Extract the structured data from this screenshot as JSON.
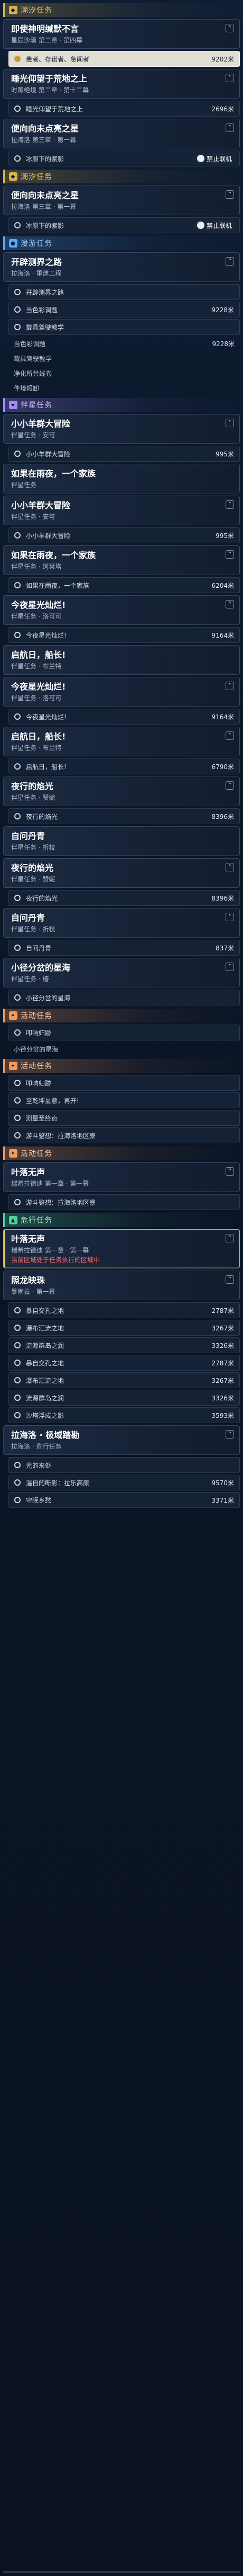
{
  "sections": {
    "chaoxi": "潮汐任务",
    "manyou": "漫游任务",
    "banxing": "伴星任务",
    "huodong": "活动任务",
    "weixian": "危行任务"
  },
  "cards": {
    "c1": {
      "title": "即使神明缄默不言",
      "sub": "星辰沙漠 第二章 · 第四幕"
    },
    "c2": {
      "title": "睡光仰望于荒地之上",
      "sub": "时隙绝境 第二章 · 第十二幕"
    },
    "c3": {
      "title": "便向向未点亮之星",
      "sub": "拉海洛 第三章 · 第一幕"
    },
    "c4": {
      "title": "便向向未点亮之星",
      "sub": "拉海洛 第三章 · 第一幕"
    },
    "c5": {
      "title": "开辟测界之路",
      "sub": "拉海洛 · 重建工程"
    },
    "c6": {
      "title": "小小羊群大冒险",
      "sub": "伴星任务 · 安可"
    },
    "c7": {
      "title": "如果在雨夜，一个家族",
      "sub": "伴星任务"
    },
    "c8": {
      "title": "小小羊群大冒险",
      "sub": "伴星任务 · 安可"
    },
    "c9": {
      "title": "如果在雨夜，一个家族",
      "sub": "伴星任务 · 珂莱塔"
    },
    "c10": {
      "title": "今夜星光灿烂!",
      "sub": "伴星任务 · 洛可可"
    },
    "c11": {
      "title": "启航日，船长!",
      "sub": "伴星任务 · 布兰特"
    },
    "c12": {
      "title": "今夜星光灿烂!",
      "sub": "伴星任务 · 洛可可"
    },
    "c13": {
      "title": "启航日，船长!",
      "sub": "伴星任务 · 布兰特"
    },
    "c14": {
      "title": "夜行的焰光",
      "sub": "伴星任务 · 赞妮"
    },
    "c15": {
      "title": "自问丹青",
      "sub": "伴星任务 · 折枝"
    },
    "c16": {
      "title": "夜行的焰光",
      "sub": "伴星任务 · 赞妮"
    },
    "c17": {
      "title": "自问丹青",
      "sub": "伴星任务 · 折枝"
    },
    "c18": {
      "title": "小径分岔的星海",
      "sub": "伴星任务 · 椿"
    },
    "c19": {
      "title": "叶落无声",
      "sub": "瑞希拉德迪 第一章 · 第一幕"
    },
    "c20": {
      "title": "叶落无声",
      "sub": "瑞希拉德迪 第一章 · 第一幕",
      "warn": "当前区域处于任务执行的区域中"
    },
    "c21": {
      "title": "照龙映珠",
      "sub": "暴雨云 · 第一幕"
    },
    "c22": {
      "title": "拉海洛 · 极域踏勘",
      "sub": "拉海洛 · 危行任务"
    }
  },
  "rows": {
    "r1": {
      "label": "患者、存诺者、急闻者",
      "dist": "9202米"
    },
    "r2": {
      "label": "睡光仰望于荒地之上",
      "dist": "2696米"
    },
    "r3": {
      "label": "冰原下的紫影",
      "dist": ""
    },
    "r4": {
      "label": "冰原下的紫影",
      "dist": ""
    },
    "r5": {
      "label": "开辟测界之路",
      "dist": ""
    },
    "r6": {
      "label": "当色彩调题",
      "dist": "9228米"
    },
    "r7": {
      "label": "载具驾驶教学",
      "dist": ""
    },
    "r8": {
      "label": "当色彩调题",
      "dist": "9228米"
    },
    "r9": {
      "label": "载具驾驶教学",
      "dist": ""
    },
    "r10": {
      "label": "净化所共线卷",
      "dist": ""
    },
    "r11": {
      "label": "件境短卸",
      "dist": ""
    },
    "r12": {
      "label": "小小羊群大冒险",
      "dist": "995米"
    },
    "r13": {
      "label": "小小羊群大冒险",
      "dist": "995米"
    },
    "r14": {
      "label": "如果在雨夜，一个家族",
      "dist": "6204米"
    },
    "r15": {
      "label": "今夜星光灿烂!",
      "dist": "9164米"
    },
    "r16": {
      "label": "今夜星光灿烂!",
      "dist": "9164米"
    },
    "r17": {
      "label": "启航日，船长!",
      "dist": "6790米"
    },
    "r18": {
      "label": "夜行的焰光",
      "dist": "8396米"
    },
    "r19": {
      "label": "夜行的焰光",
      "dist": "8396米"
    },
    "r20": {
      "label": "自问丹青",
      "dist": "837米"
    },
    "r21": {
      "label": "小径分岔的星海",
      "dist": ""
    },
    "r22": {
      "label": "叩响归跡",
      "dist": ""
    },
    "r23": {
      "label": "小径分岔的星海",
      "dist": ""
    },
    "r24": {
      "label": "叩响归跡",
      "dist": ""
    },
    "r25": {
      "label": "至乾坤显意，再开!",
      "dist": ""
    },
    "r26": {
      "label": "测量至终点",
      "dist": ""
    },
    "r27": {
      "label": "游斗鉴想：拉海洛地区寮",
      "dist": ""
    },
    "r28": {
      "label": "游斗鉴想：拉海洛地区寮",
      "dist": ""
    },
    "r29": {
      "label": "暴自交孔之地",
      "dist": "2787米"
    },
    "r30": {
      "label": "瀑布汇流之地",
      "dist": "3267米"
    },
    "r31": {
      "label": "流源群岛之润",
      "dist": "3326米"
    },
    "r32": {
      "label": "暴自交孔之地",
      "dist": "2787米"
    },
    "r33": {
      "label": "瀑布汇流之地",
      "dist": "3267米"
    },
    "r34": {
      "label": "流源群岛之润",
      "dist": "3326米"
    },
    "r35": {
      "label": "沙塔浮成之影",
      "dist": "3593米"
    },
    "r36": {
      "label": "光的来处",
      "dist": ""
    },
    "r37": {
      "label": "温自的断影：拉乐高原",
      "dist": "9570米"
    },
    "r38": {
      "label": "守眠乡愁",
      "dist": "3371米"
    }
  },
  "badges": {
    "b1": "禁止联机",
    "b2": "禁止联机"
  }
}
